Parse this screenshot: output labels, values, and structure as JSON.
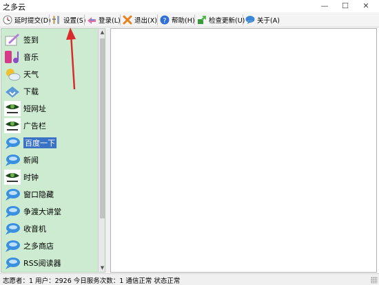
{
  "window": {
    "title": "之多云",
    "min": "—",
    "max": "☐",
    "close": "✕"
  },
  "toolbar": {
    "items": [
      {
        "label": "延时提交(D)",
        "icon": "clock-icon"
      },
      {
        "label": "设置(S)",
        "icon": "settings-icon"
      },
      {
        "label": "登录(L)",
        "icon": "login-icon"
      },
      {
        "label": "退出(X)",
        "icon": "exit-icon"
      },
      {
        "label": "帮助(H)",
        "icon": "help-icon"
      },
      {
        "label": "检查更新(U)",
        "icon": "update-icon"
      },
      {
        "label": "关于(A)",
        "icon": "about-icon"
      }
    ]
  },
  "sidebar": {
    "items": [
      {
        "label": "签到",
        "icon": "signin-icon"
      },
      {
        "label": "音乐",
        "icon": "music-icon"
      },
      {
        "label": "天气",
        "icon": "weather-icon"
      },
      {
        "label": "下载",
        "icon": "download-icon"
      },
      {
        "label": "短网址",
        "icon": "eye-logo-icon"
      },
      {
        "label": "广告栏",
        "icon": "eye-logo-icon"
      },
      {
        "label": "百度一下",
        "icon": "cloud-chat-icon"
      },
      {
        "label": "新闻",
        "icon": "cloud-chat-icon"
      },
      {
        "label": "时钟",
        "icon": "eye-logo-icon"
      },
      {
        "label": "窗口隐藏",
        "icon": "cloud-chat-icon"
      },
      {
        "label": "争渡大讲堂",
        "icon": "cloud-chat-icon"
      },
      {
        "label": "收音机",
        "icon": "cloud-chat-icon"
      },
      {
        "label": "之多商店",
        "icon": "cloud-chat-icon"
      },
      {
        "label": "RSS阅读器",
        "icon": "cloud-chat-icon"
      }
    ],
    "selected": "百度一下"
  },
  "statusbar": {
    "text": "志愿者：1 用户：2926 今日服务次数：1 通信正常 状态正常"
  },
  "colors": {
    "sidebar_bg": "#ccebd0",
    "selection": "#3b73c4",
    "annotation_arrow": "#d92b2b"
  }
}
